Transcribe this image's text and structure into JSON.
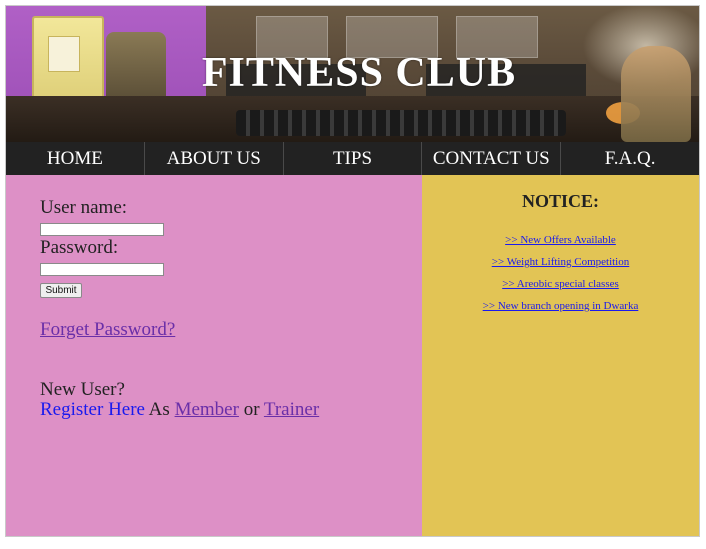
{
  "banner": {
    "title": "FITNESS CLUB"
  },
  "nav": {
    "items": [
      "HOME",
      "ABOUT US",
      "TIPS",
      "CONTACT US",
      "F.A.Q."
    ]
  },
  "login": {
    "username_label": "User name:",
    "username_value": "",
    "password_label": "Password:",
    "password_value": "",
    "submit_label": "Submit",
    "forgot_label": "Forget Password?",
    "new_user_label": "New User?",
    "register_label": "Register Here",
    "as_text": " As ",
    "member_label": "Member",
    "or_text": " or ",
    "trainer_label": "Trainer"
  },
  "notice": {
    "title": "NOTICE:",
    "items": [
      ">> New Offers Available",
      ">> Weight Lifting Competition",
      ">> Areobic special classes",
      ">> New branch opening in Dwarka"
    ]
  },
  "colors": {
    "left_panel": "#dd90c6",
    "right_panel": "#e2c455",
    "nav_bg": "#222222",
    "link": "#1a1aee",
    "visited_link": "#6a2fa8"
  }
}
